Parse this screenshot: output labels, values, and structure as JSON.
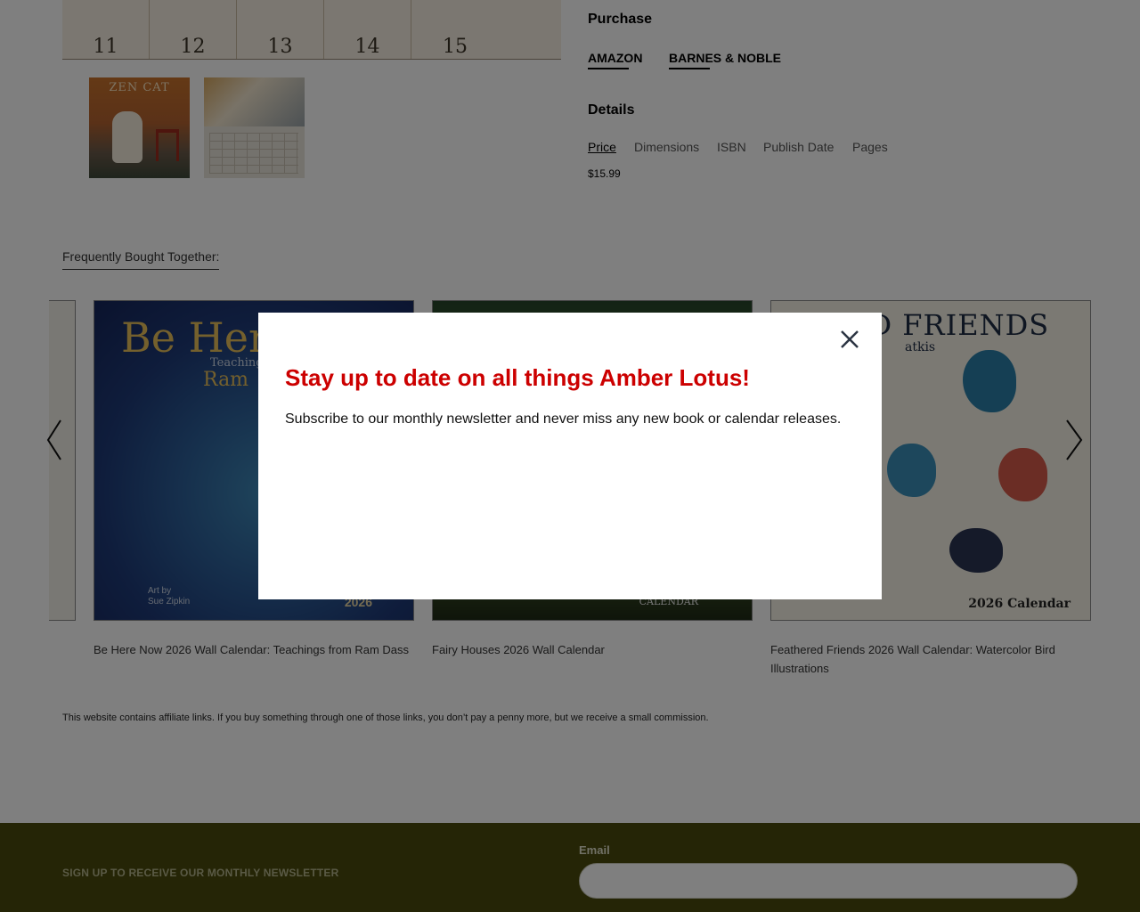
{
  "calendar_strip": {
    "days": [
      "11",
      "12",
      "13",
      "14",
      "15"
    ]
  },
  "thumbnails": [
    {
      "title": "ZEN CAT",
      "alt": "Zen Cat calendar cover thumbnail"
    },
    {
      "title": "",
      "alt": "Calendar interior page thumbnail"
    }
  ],
  "purchase": {
    "heading": "Purchase",
    "links": [
      "AMAZON",
      "BARNES & NOBLE"
    ]
  },
  "details": {
    "heading": "Details",
    "tabs": [
      "Price",
      "Dimensions",
      "ISBN",
      "Publish Date",
      "Pages"
    ],
    "active_tab": "Price",
    "value": "$15.99"
  },
  "fbt": {
    "heading": "Frequently Bought Together:",
    "products": [
      {
        "title": "Be Here Now 2026 Wall Calendar: Teachings from Ram Dass",
        "cover_title": "Be Here",
        "cover_subtitle": "Teaching",
        "cover_name": "Ram",
        "cover_art_line1": "Art by",
        "cover_art_line2": "Sue Zipkin",
        "cover_year": "2026"
      },
      {
        "title": "Fairy Houses 2026 Wall Calendar",
        "cover_label": "CALENDAR"
      },
      {
        "title": "Feathered Friends 2026 Wall Calendar: Watercolor Bird Illustrations",
        "cover_title": "RED FRIENDS",
        "cover_sub": "atkis",
        "cover_year": "2026 Calendar"
      }
    ]
  },
  "affiliate_note": "This website contains affiliate links. If you buy something through one of those links, you don’t pay a penny more, but we receive a small commission.",
  "footer": {
    "newsletter_label": "SIGN UP TO RECEIVE OUR MONTHLY NEWSLETTER",
    "email_label": "Email",
    "email_value": "",
    "background": "#4a4a0c"
  },
  "modal": {
    "title": "Stay up to date on all things Amber Lotus!",
    "text": "Subscribe to our monthly newsletter and never miss any new book or calendar releases.",
    "close_icon": "close-icon",
    "title_color": "#cc0000"
  }
}
